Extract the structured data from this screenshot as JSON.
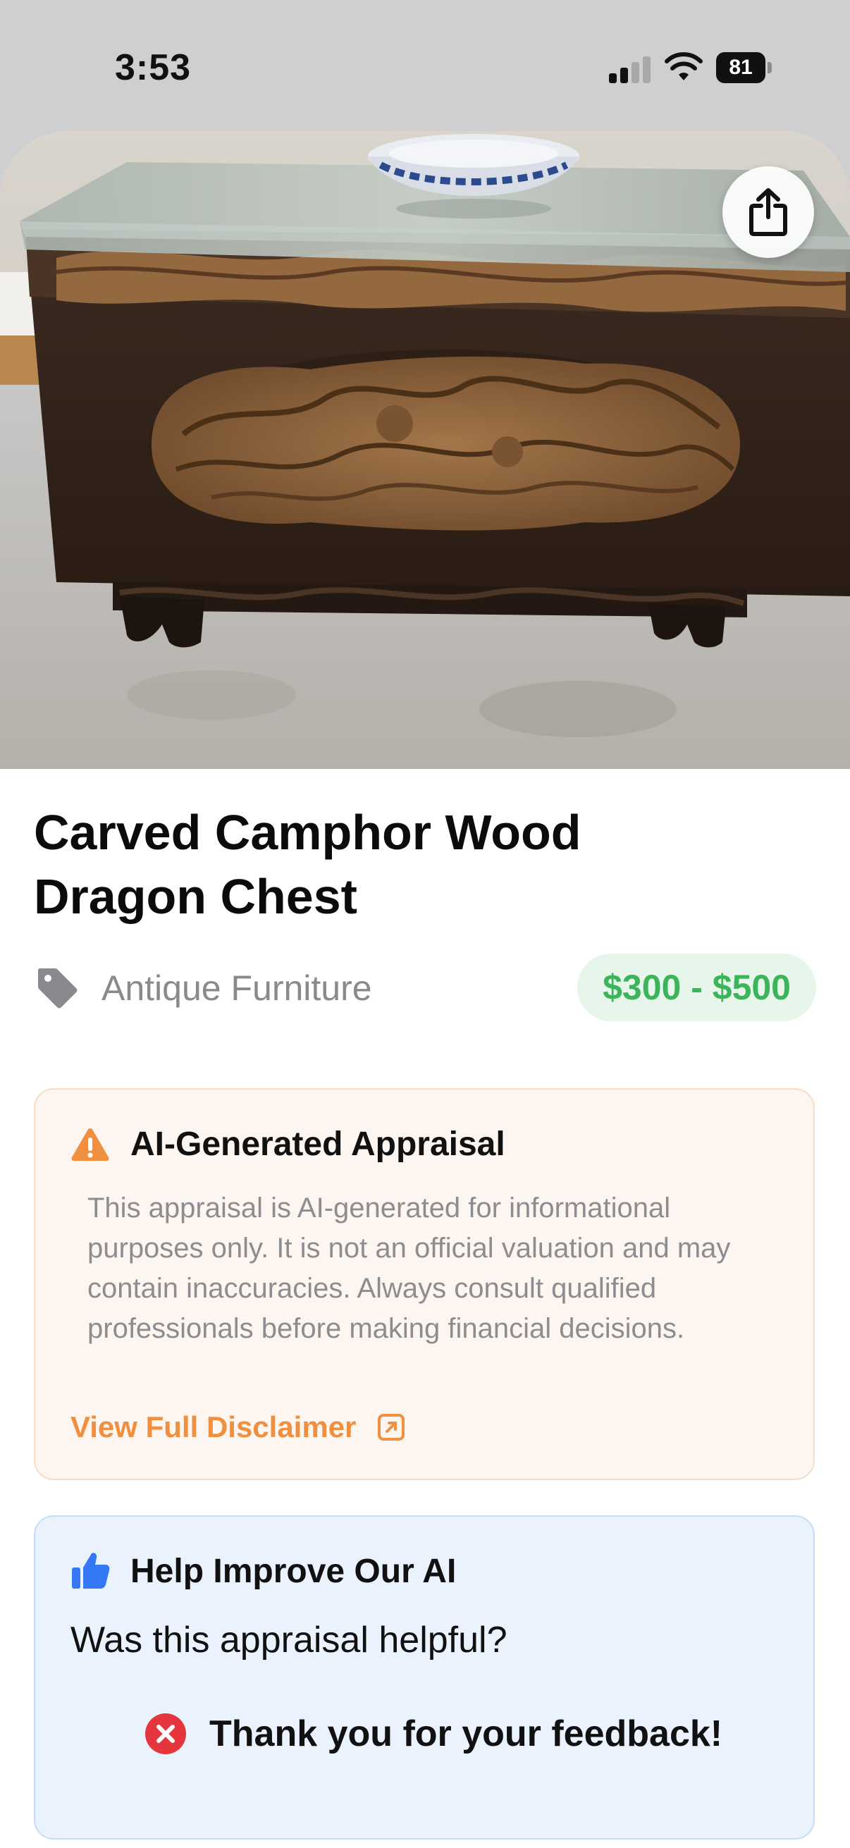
{
  "status_bar": {
    "time": "3:53",
    "battery": "81"
  },
  "item": {
    "title": "Carved Camphor Wood Dragon Chest",
    "category": "Antique Furniture",
    "price_range": "$300 - $500"
  },
  "disclaimer": {
    "title": "AI-Generated Appraisal",
    "body": "This appraisal is AI-generated for informational purposes only. It is not an official valuation and may contain inaccuracies. Always consult qualified professionals before making financial decisions.",
    "link_label": "View Full Disclaimer"
  },
  "feedback": {
    "title": "Help Improve Our AI",
    "question": "Was this appraisal helpful?",
    "thanks": "Thank you for your feedback!"
  },
  "icons": {
    "share": "share-icon",
    "tag": "tag-icon",
    "warning": "warning-icon",
    "external_link": "external-link-icon",
    "thumbs_up": "thumbs-up-icon",
    "error": "x-circle-icon"
  },
  "colors": {
    "accent_orange": "#ef8f3f",
    "price_green": "#3cb45a",
    "thumb_blue": "#3478f6",
    "error_red": "#e5363d"
  }
}
